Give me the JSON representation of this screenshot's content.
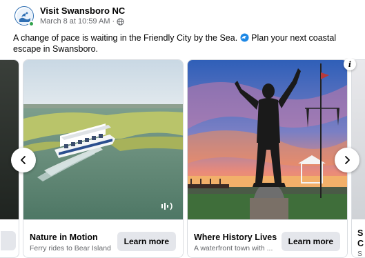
{
  "post": {
    "page_name": "Visit Swansboro NC",
    "timestamp": "March 8 at 10:59 AM",
    "separator": "·",
    "audience_icon": "globe-icon",
    "text_before": "A change of pace is waiting in the Friendly City by the Sea. ",
    "text_after": " Plan your next coastal escape in Swansboro."
  },
  "carousel": {
    "cards": [
      {
        "title": "Nature in Motion",
        "subtitle": "Ferry rides to Bear Island",
        "cta": "Learn more",
        "icon": "sound-icon"
      },
      {
        "title": "Where History Lives",
        "subtitle": "A waterfront town with ...",
        "cta": "Learn more"
      }
    ],
    "next_card_partial": {
      "title_fragment": "S",
      "title_fragment_2": "C",
      "subtitle_fragment": "S"
    },
    "info_badge": "i",
    "colors": {
      "button_bg": "#e4e6eb",
      "online": "#31a24c",
      "meta_text": "#65676b"
    }
  }
}
